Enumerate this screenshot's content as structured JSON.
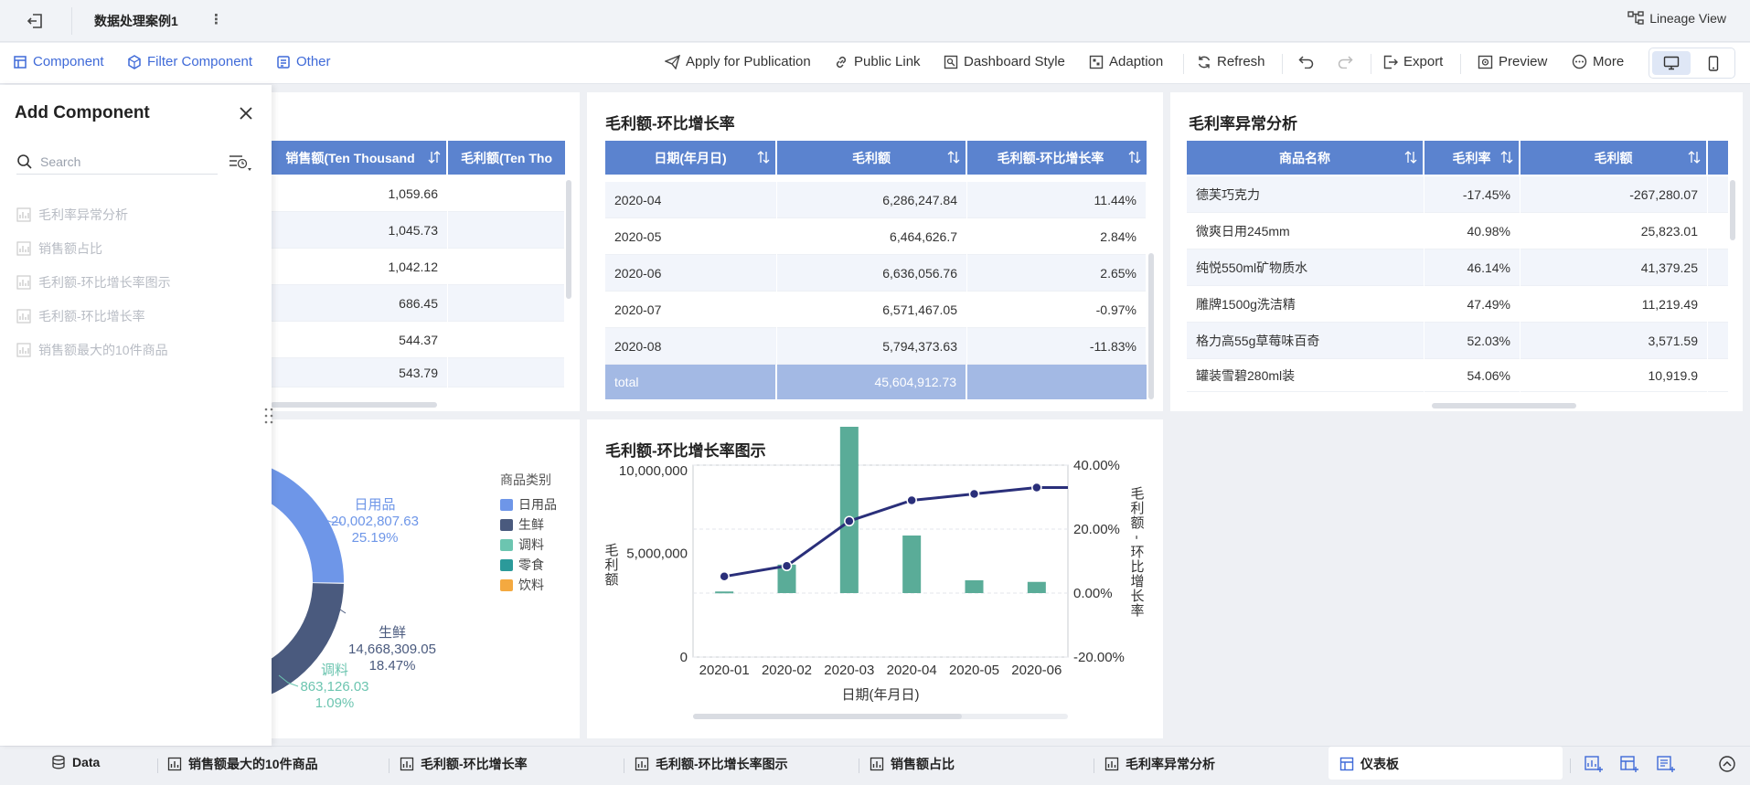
{
  "topbar": {
    "title": "数据处理案例1",
    "more": "⋮",
    "lineage_label": "Lineage View"
  },
  "toolbar": {
    "left": [
      {
        "label": "Component",
        "icon": "component-icon"
      },
      {
        "label": "Filter Component",
        "icon": "filter-component-icon"
      },
      {
        "label": "Other",
        "icon": "other-icon"
      }
    ],
    "right": {
      "publish": "Apply for Publication",
      "public_link": "Public Link",
      "dashboard_style": "Dashboard Style",
      "adaption": "Adaption",
      "refresh": "Refresh",
      "export": "Export",
      "preview": "Preview",
      "more": "More"
    }
  },
  "panel": {
    "title": "Add Component",
    "search_placeholder": "Search",
    "items": [
      "毛利率异常分析",
      "销售额占比",
      "毛利额-环比增长率图示",
      "毛利额-环比增长率",
      "销售额最大的10件商品"
    ]
  },
  "card_sales": {
    "columns": [
      "销售额(Ten Thousand",
      "毛利额(Ten Tho"
    ],
    "rows": [
      "1,059.66",
      "1,045.73",
      "1,042.12",
      "686.45",
      "544.37",
      "543.79"
    ]
  },
  "card_growth": {
    "title": "毛利额-环比增长率",
    "columns": [
      "日期(年月日)",
      "毛利额",
      "毛利额-环比增长率"
    ],
    "rows": [
      [
        "2020-04",
        "6,286,247.84",
        "11.44%"
      ],
      [
        "2020-05",
        "6,464,626.7",
        "2.84%"
      ],
      [
        "2020-06",
        "6,636,056.76",
        "2.65%"
      ],
      [
        "2020-07",
        "6,571,467.05",
        "-0.97%"
      ],
      [
        "2020-08",
        "5,794,373.63",
        "-11.83%"
      ]
    ],
    "total": [
      "total",
      "45,604,912.73",
      ""
    ]
  },
  "card_margin": {
    "title": "毛利率异常分析",
    "columns": [
      "商品名称",
      "毛利率",
      "毛利额"
    ],
    "rows": [
      [
        "德芙巧克力",
        "-17.45%",
        "-267,280.07"
      ],
      [
        "微爽日用245mm",
        "40.98%",
        "25,823.01"
      ],
      [
        "纯悦550ml矿物质水",
        "46.14%",
        "41,379.25"
      ],
      [
        "雕牌1500g洗洁精",
        "47.49%",
        "11,219.49"
      ],
      [
        "格力高55g草莓味百奇",
        "52.03%",
        "3,571.59"
      ],
      [
        "罐装雪碧280ml装",
        "54.06%",
        "10,919.9"
      ]
    ]
  },
  "pie": {
    "legend_title": "商品类别",
    "legend": [
      {
        "name": "日用品",
        "color": "#6e96e8"
      },
      {
        "name": "生鲜",
        "color": "#4a5a7e"
      },
      {
        "name": "调料",
        "color": "#6cc5b0"
      },
      {
        "name": "零食",
        "color": "#2b9a9a"
      },
      {
        "name": "饮料",
        "color": "#f4a940"
      }
    ],
    "labels": [
      {
        "name": "日用品",
        "value": "20,002,807.63",
        "pct": "25.19%"
      },
      {
        "name": "生鲜",
        "value": "14,668,309.05",
        "pct": "18.47%"
      },
      {
        "name": "调料",
        "value": "863,126.03",
        "pct": "1.09%"
      }
    ]
  },
  "chart_data": {
    "type": "bar",
    "title": "毛利额-环比增长率图示",
    "xlabel": "日期(年月日)",
    "ylabel": "毛利额",
    "ylabel_right": "毛利额-环比增长率",
    "categories": [
      "2020-01",
      "2020-02",
      "2020-03",
      "2020-04",
      "2020-05",
      "2020-06"
    ],
    "y_ticks": [
      "10,000,000",
      "5,000,000",
      "0"
    ],
    "y2_ticks": [
      "40.00%",
      "20.00%",
      "0.00%",
      "-20.00%"
    ],
    "ylim": [
      0,
      10000000
    ],
    "y2lim": [
      -20,
      40
    ],
    "series": [
      {
        "name": "毛利额",
        "kind": "bar",
        "color": "#5aac98",
        "values": [
          0.5,
          8.9,
          52,
          18,
          4,
          3.5
        ]
      },
      {
        "name": "毛利额-环比增长率",
        "kind": "line",
        "color": "#2a2f7a",
        "values": [
          5.2,
          8.5,
          22.5,
          29,
          31,
          33
        ]
      }
    ]
  },
  "tabs": {
    "data": "Data",
    "items": [
      "销售额最大的10件商品",
      "毛利额-环比增长率",
      "毛利额-环比增长率图示",
      "销售额占比",
      "毛利率异常分析"
    ],
    "active": "仪表板"
  }
}
